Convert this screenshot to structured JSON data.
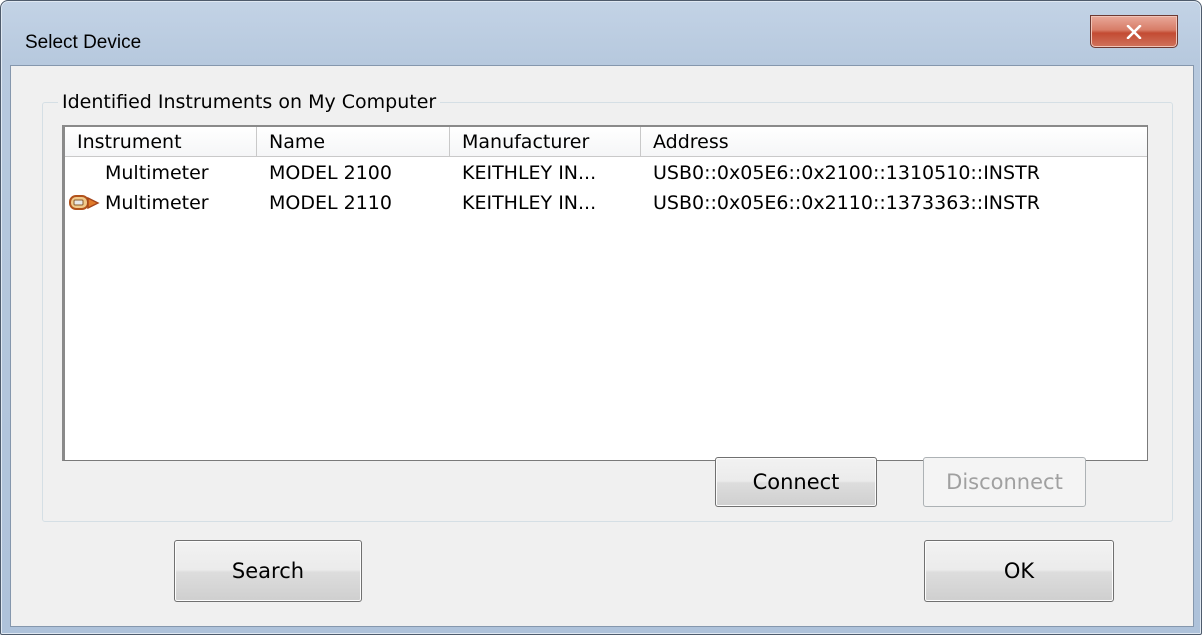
{
  "window": {
    "title": "Select Device",
    "close_glyph": "x"
  },
  "group": {
    "legend": "Identified Instruments on My Computer"
  },
  "list": {
    "columns": [
      "Instrument",
      "Name",
      "Manufacturer",
      "Address"
    ],
    "rows": [
      {
        "icon": "",
        "instrument": "Multimeter",
        "name": "MODEL 2100",
        "manufacturer": "KEITHLEY IN...",
        "address": "USB0::0x05E6::0x2100::1310510::INSTR"
      },
      {
        "icon": "usb-plug-icon",
        "instrument": "Multimeter",
        "name": "MODEL 2110",
        "manufacturer": "KEITHLEY IN...",
        "address": "USB0::0x05E6::0x2110::1373363::INSTR"
      }
    ]
  },
  "buttons": {
    "connect": "Connect",
    "disconnect": "Disconnect",
    "search": "Search",
    "ok": "OK"
  },
  "colors": {
    "frame": "#b9cbe0",
    "close_button": "#c84a34",
    "client": "#f0f0f0",
    "disabled_text": "#a0a0a0"
  }
}
